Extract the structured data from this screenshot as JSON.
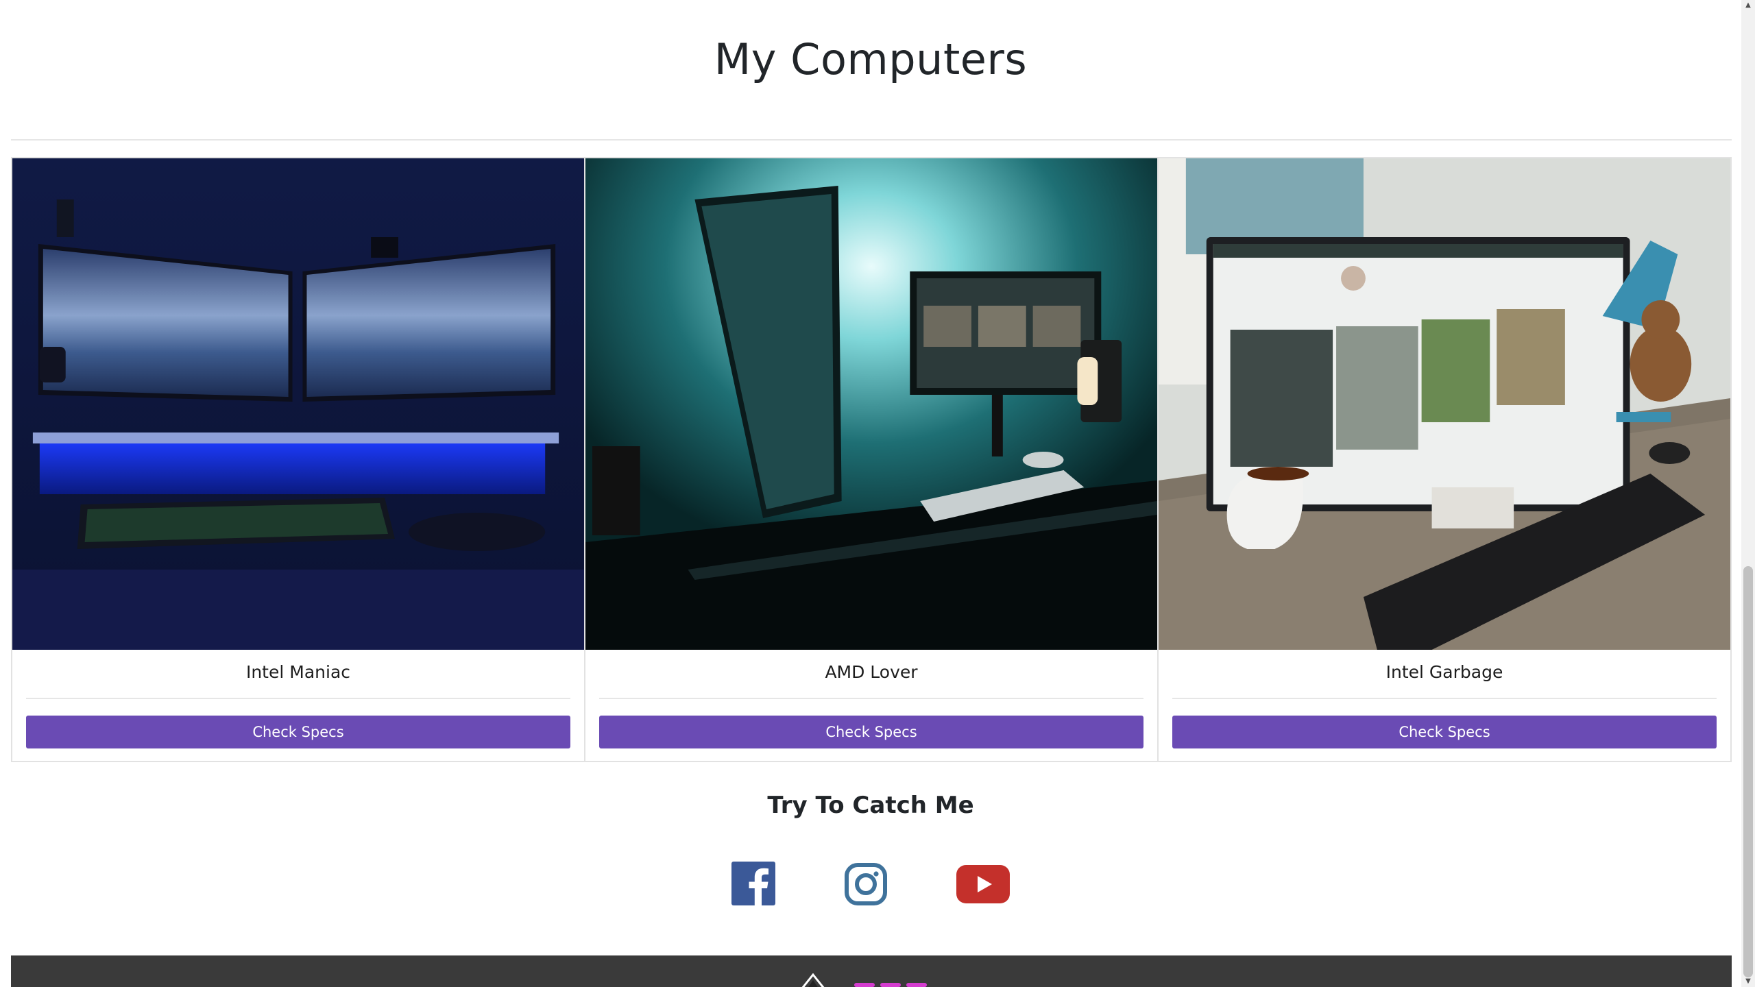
{
  "computers_section": {
    "title": "My Computers",
    "cards": [
      {
        "name": "Intel Maniac",
        "image": "dual-monitor-blue-desk-photo",
        "button_label": "Check Specs"
      },
      {
        "name": "AMD Lover",
        "image": "vertical-monitor-teal-desk-photo",
        "button_label": "Check Specs"
      },
      {
        "name": "Intel Garbage",
        "image": "monitor-keyboard-teddy-lamp-photo",
        "button_label": "Check Specs"
      }
    ]
  },
  "social_section": {
    "title": "Try To Catch Me",
    "links": [
      {
        "icon": "facebook-icon",
        "color": "#3b5998"
      },
      {
        "icon": "instagram-icon",
        "color": "#3f729b"
      },
      {
        "icon": "youtube-icon",
        "color": "#c4302b"
      }
    ]
  },
  "colors": {
    "button": "#6a4bb4",
    "footer": "#3a3a3a"
  }
}
